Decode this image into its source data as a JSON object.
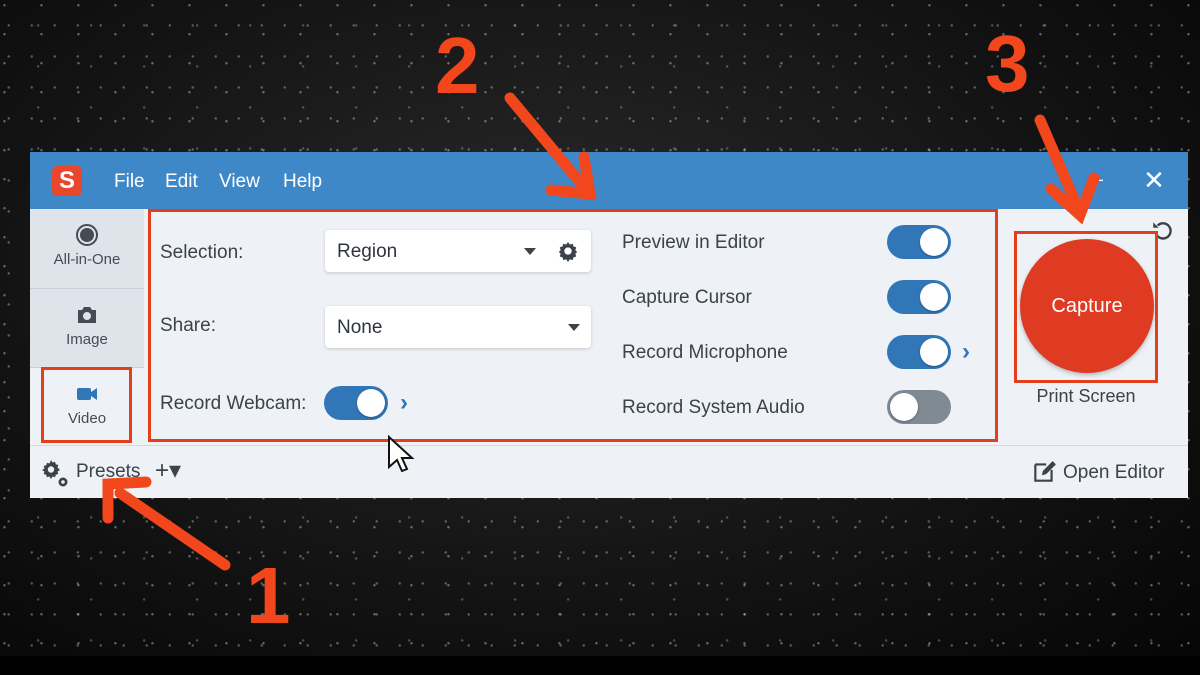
{
  "app": {
    "logo_letter": "S",
    "brand_color": "#e8472b",
    "titlebar_color": "#3f88c8"
  },
  "menu": [
    "File",
    "Edit",
    "View",
    "Help"
  ],
  "window_controls": {
    "minimize": "–",
    "close": "✕"
  },
  "sidebar": {
    "items": [
      {
        "label": "All-in-One",
        "icon": "record-dot-icon"
      },
      {
        "label": "Image",
        "icon": "camera-icon"
      },
      {
        "label": "Video",
        "icon": "video-camera-icon",
        "selected": true
      }
    ]
  },
  "settings": {
    "selection": {
      "label": "Selection:",
      "value": "Region"
    },
    "share": {
      "label": "Share:",
      "value": "None"
    },
    "webcam": {
      "label": "Record Webcam:",
      "on": true
    },
    "toggles": [
      {
        "label": "Preview in Editor",
        "on": true
      },
      {
        "label": "Capture Cursor",
        "on": true
      },
      {
        "label": "Record Microphone",
        "on": true
      },
      {
        "label": "Record System Audio",
        "on": false
      }
    ]
  },
  "capture": {
    "label": "Capture",
    "shortcut": "Print Screen",
    "color": "#df3b23"
  },
  "footer": {
    "presets_label": "Presets",
    "add_label": "+▾",
    "open_editor_label": "Open Editor"
  },
  "annotations": {
    "one": "1",
    "two": "2",
    "three": "3",
    "color": "#f2461c"
  }
}
